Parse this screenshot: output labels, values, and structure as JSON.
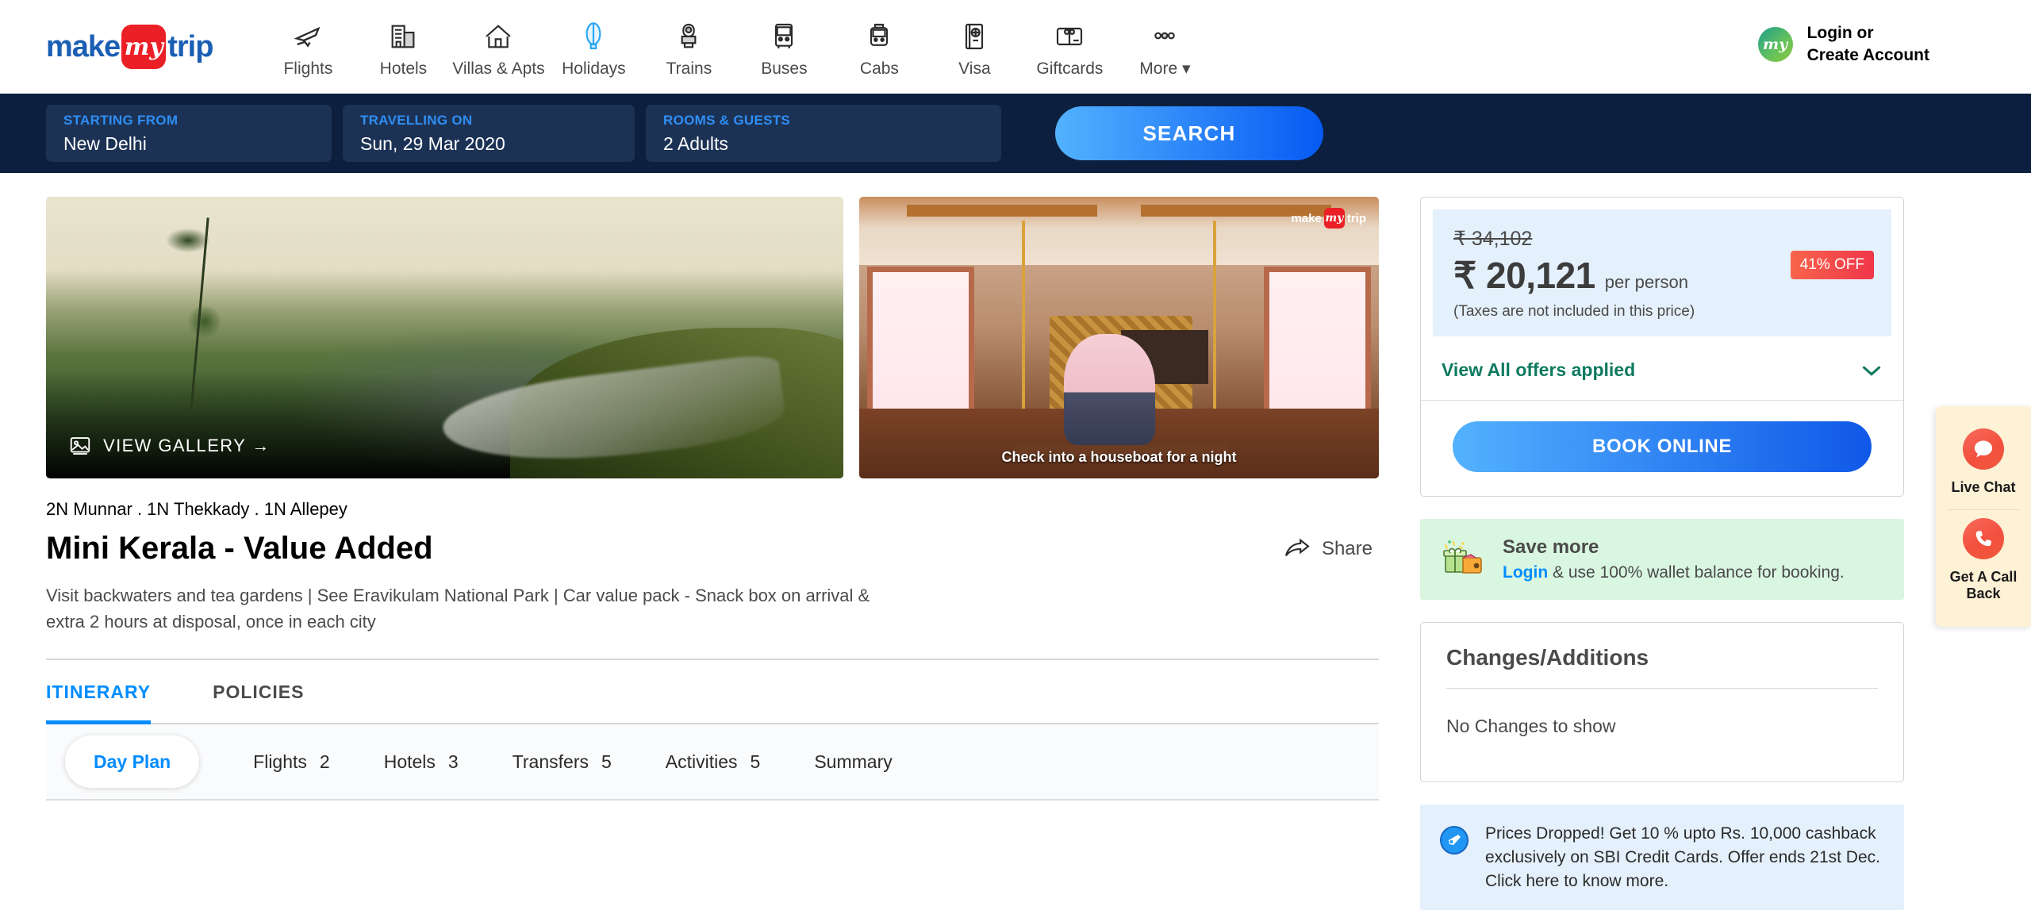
{
  "brand": {
    "logo_make": "make",
    "logo_my": "my",
    "logo_trip": "trip"
  },
  "nav": {
    "items": [
      {
        "label": "Flights",
        "icon": "airplane-icon"
      },
      {
        "label": "Hotels",
        "icon": "building-icon"
      },
      {
        "label": "Villas & Apts",
        "icon": "house-icon"
      },
      {
        "label": "Holidays",
        "icon": "hot-air-balloon-icon"
      },
      {
        "label": "Trains",
        "icon": "train-icon"
      },
      {
        "label": "Buses",
        "icon": "bus-icon"
      },
      {
        "label": "Cabs",
        "icon": "cab-icon"
      },
      {
        "label": "Visa",
        "icon": "passport-icon"
      },
      {
        "label": "Giftcards",
        "icon": "giftcard-icon"
      },
      {
        "label": "More",
        "icon": "more-dots-icon"
      }
    ]
  },
  "account": {
    "avatar_text": "my",
    "line1": "Login or",
    "line2": "Create Account"
  },
  "search": {
    "fields": [
      {
        "label": "STARTING FROM",
        "value": "New Delhi"
      },
      {
        "label": "TRAVELLING ON",
        "value": "Sun, 29 Mar 2020"
      },
      {
        "label": "ROOMS & GUESTS",
        "value": "2 Adults"
      }
    ],
    "button": "SEARCH"
  },
  "gallery": {
    "view_gallery": "VIEW GALLERY",
    "view_gallery_arrow": "→",
    "video_caption": "Check into a houseboat for a night",
    "video_logo_make": "make",
    "video_logo_my": "my",
    "video_logo_trip": "trip"
  },
  "package": {
    "route": "2N Munnar . 1N Thekkady . 1N Allepey",
    "title": "Mini Kerala - Value Added",
    "share_label": "Share",
    "description": "Visit backwaters and tea gardens | See Eravikulam National Park | Car value pack - Snack box on arrival & extra 2 hours at disposal, once in each city"
  },
  "tabs": [
    {
      "label": "ITINERARY",
      "active": true
    },
    {
      "label": "POLICIES",
      "active": false
    }
  ],
  "subnav": {
    "active_pill": "Day Plan",
    "items": [
      {
        "label": "Flights",
        "count": "2"
      },
      {
        "label": "Hotels",
        "count": "3"
      },
      {
        "label": "Transfers",
        "count": "5"
      },
      {
        "label": "Activities",
        "count": "5"
      },
      {
        "label": "Summary",
        "count": ""
      }
    ]
  },
  "price_card": {
    "old_price": "₹ 34,102",
    "new_price": "₹ 20,121",
    "per_person": "per person",
    "tax_note": "(Taxes are not included in this price)",
    "discount_badge": "41% OFF",
    "offers_link": "View All offers applied",
    "book_button": "BOOK ONLINE"
  },
  "save_more": {
    "title": "Save more",
    "login_link": "Login",
    "rest": " & use 100% wallet balance for booking."
  },
  "changes": {
    "title": "Changes/Additions",
    "empty": "No Changes to show"
  },
  "sbi_offer": {
    "text": "Prices Dropped! Get 10 % upto Rs. 10,000 cashback exclusively on SBI Credit Cards. Offer ends 21st Dec. Click here to know more."
  },
  "float_widget": {
    "live_chat": "Live Chat",
    "call_back": "Get A Call Back"
  },
  "colors": {
    "brand_red": "#eb2026",
    "brand_blue": "#1a5fb4",
    "accent_blue": "#008cff",
    "dark_navy": "#0c1f3f",
    "green_offer": "#0e7a5f",
    "save_green_bg": "#d9f6e0",
    "price_bg": "#e4f0fb",
    "widget_bg": "#fdf1d6"
  }
}
